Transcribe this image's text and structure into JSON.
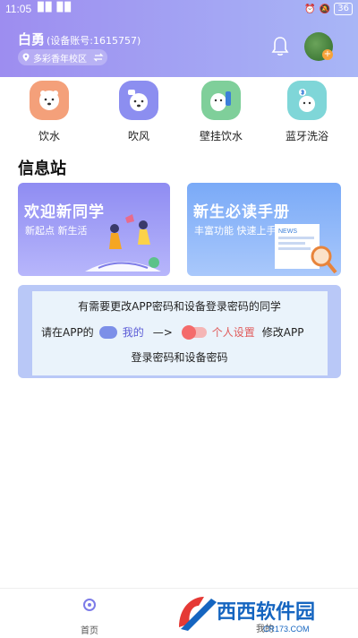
{
  "status_bar": {
    "time": "11:05",
    "signal_text": "▉▉ ▉▉",
    "battery": "36"
  },
  "header": {
    "user_name": "白勇",
    "account_label": "(设备账号:1615757)",
    "campus": "多彩香年校区"
  },
  "features": [
    {
      "label": "饮水",
      "icon": "polar-bear-water-icon",
      "color": "#f4a07a"
    },
    {
      "label": "吹风",
      "icon": "polar-bear-hairdryer-icon",
      "color": "#8c8ef0"
    },
    {
      "label": "壁挂饮水",
      "icon": "wall-dispenser-icon",
      "color": "#7fcf9a"
    },
    {
      "label": "蓝牙洗浴",
      "icon": "bluetooth-bath-icon",
      "color": "#7fd6d8"
    }
  ],
  "info_station": {
    "title": "信息站",
    "cards": [
      {
        "title": "欢迎新同学",
        "subtitle": "新起点  新生活"
      },
      {
        "title": "新生必读手册",
        "subtitle": "丰富功能  快速上手",
        "art_text": "NEWS"
      }
    ],
    "notice": {
      "line1": "有需要更改APP密码和设备登录密码的同学",
      "line2_prefix": "请在APP的",
      "mine": "我的",
      "arrow": "—>",
      "personal_settings": "个人设置",
      "line2_suffix": "修改APP",
      "line3": "登录密码和设备密码"
    }
  },
  "bottom_nav": {
    "home": "首页",
    "mine": "我的"
  },
  "watermark": {
    "text": "西西软件园",
    "sub": "CR173.COM"
  },
  "colors": {
    "header_start": "#9d8df0",
    "header_end": "#a8b6f6",
    "accent": "#f7a33a"
  }
}
